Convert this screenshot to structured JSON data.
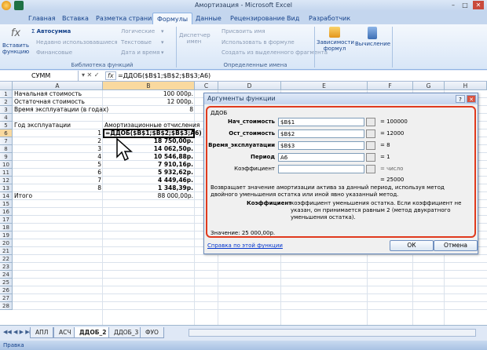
{
  "window": {
    "title": "Амортизация - Microsoft Excel",
    "min": "–",
    "max": "□",
    "close": "✕"
  },
  "tabs": [
    "Главная",
    "Вставка",
    "Разметка страницы",
    "Формулы",
    "Данные",
    "Рецензирование",
    "Вид",
    "Разработчик"
  ],
  "active_tab": "Формулы",
  "ribbon": {
    "insert_function": "Вставить функцию",
    "autosum": "Автосумма",
    "recent": "Недавно использовавшиеся",
    "financial": "Финансовые",
    "logical": "Логические",
    "text": "Текстовые",
    "datetime": "Дата и время",
    "library_label": "Библиотека функций",
    "name_manager": "Диспетчер имен",
    "assign_name": "Присвоить имя",
    "use_in_formula": "Использовать в формуле",
    "create_from_selection": "Создать из выделенного фрагмента",
    "names_label": "Определенные имена",
    "dependencies": "Зависимости формул",
    "calculation": "Вычисление"
  },
  "formula_bar": {
    "name_box": "СУММ",
    "formula": "=ДДОБ($B$1;$B$2;$B$3;A6)"
  },
  "columns": [
    "A",
    "B",
    "C",
    "D",
    "E",
    "F",
    "G",
    "H"
  ],
  "rows": [
    "1",
    "2",
    "3",
    "4",
    "5",
    "6",
    "7",
    "8",
    "9",
    "10",
    "11",
    "12",
    "13",
    "14",
    "15",
    "16",
    "17",
    "18",
    "19",
    "20",
    "21",
    "22",
    "23",
    "24",
    "25",
    "26",
    "27",
    "28"
  ],
  "cells": {
    "a1": "Начальная стоимость",
    "b1": "100 000р.",
    "a2": "Остаточная стоимость",
    "b2": "12 000р.",
    "a3": "Время эксплуатации (в годах)",
    "b3": "8",
    "a5": "Год эксплуатации",
    "b5": "Амортизационные отчисления",
    "a6": "1",
    "b6": "=ДДОБ($B$1;$B$2;$B$3;A6)",
    "a7": "2",
    "b7": "18 750,00р.",
    "a8": "3",
    "b8": "14 062,50р.",
    "a9": "4",
    "b9": "10 546,88р.",
    "a10": "5",
    "b10": "7 910,16р.",
    "a11": "6",
    "b11": "5 932,62р.",
    "a12": "7",
    "b12": "4 449,46р.",
    "a13": "8",
    "b13": "1 348,39р.",
    "a14": "Итого",
    "b14": "88 000,00р."
  },
  "sheet_tabs": [
    "АПЛ",
    "АСЧ",
    "ДДОБ_2",
    "ДДОБ_3",
    "ФУО"
  ],
  "active_sheet": "ДДОБ_2",
  "status": "Правка",
  "dialog": {
    "title": "Аргументы функции",
    "func_name": "ДДОБ",
    "args": [
      {
        "label": "Нач_стоимость",
        "value": "$B$1",
        "result": "100000",
        "bold": true
      },
      {
        "label": "Ост_стоимость",
        "value": "$B$2",
        "result": "12000",
        "bold": true
      },
      {
        "label": "Время_эксплуатации",
        "value": "$B$3",
        "result": "8",
        "bold": true
      },
      {
        "label": "Период",
        "value": "A6",
        "result": "1",
        "bold": true
      },
      {
        "label": "Коэффициент",
        "value": "",
        "result": "число",
        "bold": false
      }
    ],
    "total": "25000",
    "description": "Возвращает значение амортизации актива за данный период, используя метод двойного уменьшения остатка или иной явно указанный метод.",
    "arg_name": "Коэффициент",
    "arg_desc": "коэффициент уменьшения остатка. Если коэффициент не указан, он принимается равным 2 (метод двукратного уменьшения остатка).",
    "value_label": "Значение:",
    "value": "25 000,00р.",
    "help_link": "Справка по этой функции",
    "ok": "ОК",
    "cancel": "Отмена"
  }
}
